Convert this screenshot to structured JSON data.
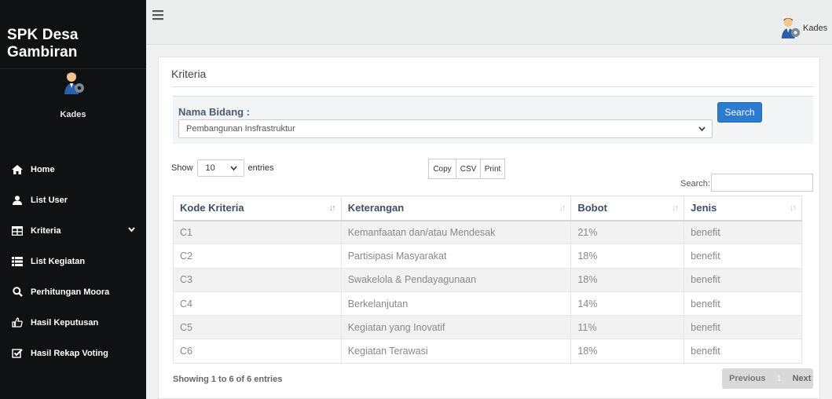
{
  "app": {
    "brand": "SPK Desa Gambiran"
  },
  "sidebar": {
    "user": "Kades",
    "items": [
      {
        "label": "Home",
        "icon": "home-icon"
      },
      {
        "label": "List User",
        "icon": "user-icon"
      },
      {
        "label": "Kriteria",
        "icon": "table-icon",
        "has_chevron": true
      },
      {
        "label": "List Kegiatan",
        "icon": "list-icon"
      },
      {
        "label": "Perhitungan Moora",
        "icon": "search-icon"
      },
      {
        "label": "Hasil Keputusan",
        "icon": "thumbs-up-icon"
      },
      {
        "label": "Hasil Rekap Voting",
        "icon": "check-square-icon"
      }
    ]
  },
  "topbar": {
    "user": "Kades"
  },
  "main": {
    "title": "Kriteria",
    "filter": {
      "label": "Nama Bidang :",
      "selected": "Pembangunan Insfrastruktur",
      "search_button": "Search"
    },
    "table_controls": {
      "show": "Show",
      "length": "10",
      "entries": "entries",
      "buttons": [
        "Copy",
        "CSV",
        "Print"
      ],
      "search_label": "Search:"
    },
    "table": {
      "columns": [
        "Kode Kriteria",
        "Keterangan",
        "Bobot",
        "Jenis"
      ],
      "rows": [
        [
          "C1",
          "Kemanfaatan dan/atau Mendesak",
          "21%",
          "benefit"
        ],
        [
          "C2",
          "Partisipasi Masyarakat",
          "18%",
          "benefit"
        ],
        [
          "C3",
          "Swakelola & Pendayagunaan",
          "18%",
          "benefit"
        ],
        [
          "C4",
          "Berkelanjutan",
          "14%",
          "benefit"
        ],
        [
          "C5",
          "Kegiatan yang Inovatif",
          "11%",
          "benefit"
        ],
        [
          "C6",
          "Kegiatan Terawasi",
          "18%",
          "benefit"
        ]
      ]
    },
    "footer": {
      "info": "Showing 1 to 6 of 6 entries",
      "previous": "Previous",
      "page": "1",
      "next": "Next"
    }
  },
  "colors": {
    "sidebar_bg": "#0f1113",
    "accent": "#2b7bd0",
    "header_text": "#3d4f66"
  }
}
